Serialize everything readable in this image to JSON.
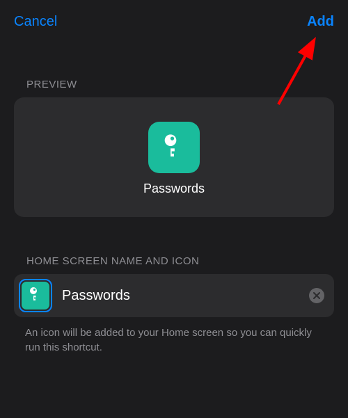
{
  "header": {
    "cancel_label": "Cancel",
    "add_label": "Add"
  },
  "preview": {
    "section_label": "PREVIEW",
    "app_name": "Passwords"
  },
  "name_section": {
    "section_label": "HOME SCREEN NAME AND ICON",
    "input_value": "Passwords",
    "helper_text": "An icon will be added to your Home screen so you can quickly run this shortcut."
  },
  "colors": {
    "accent": "#0a84ff",
    "icon_bg": "#1abc9c"
  }
}
